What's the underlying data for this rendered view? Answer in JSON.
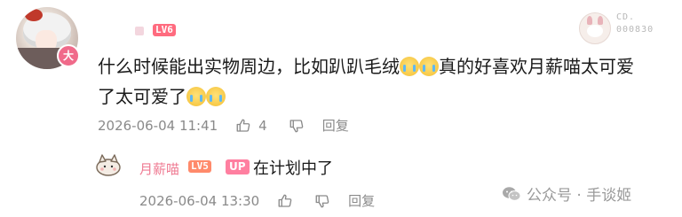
{
  "comment": {
    "level_badge": "LV6",
    "avatar_badge": "大",
    "text_segments": [
      "什么时候能出实物周边，比如趴趴毛绒",
      "真的好喜欢月薪喵太可爱了太可爱了"
    ],
    "timestamp": "2026-06-04 11:41",
    "like_count": "4",
    "reply_label": "回复"
  },
  "top_right": {
    "id_line1": "CD.",
    "id_line2": "000830"
  },
  "reply": {
    "name": "月薪喵",
    "level_badge": "LV5",
    "up_badge": "UP",
    "text": "在计划中了",
    "timestamp": "2026-06-04 13:30",
    "reply_label": "回复"
  },
  "watermark": {
    "text": "公众号 · 手谈姬"
  },
  "colors": {
    "lv6": "#ff6b7f",
    "lv5": "#ff8a6b",
    "up": "#ff7fa0",
    "reply_name": "#ef7a92",
    "meta": "#8a8a8a"
  }
}
